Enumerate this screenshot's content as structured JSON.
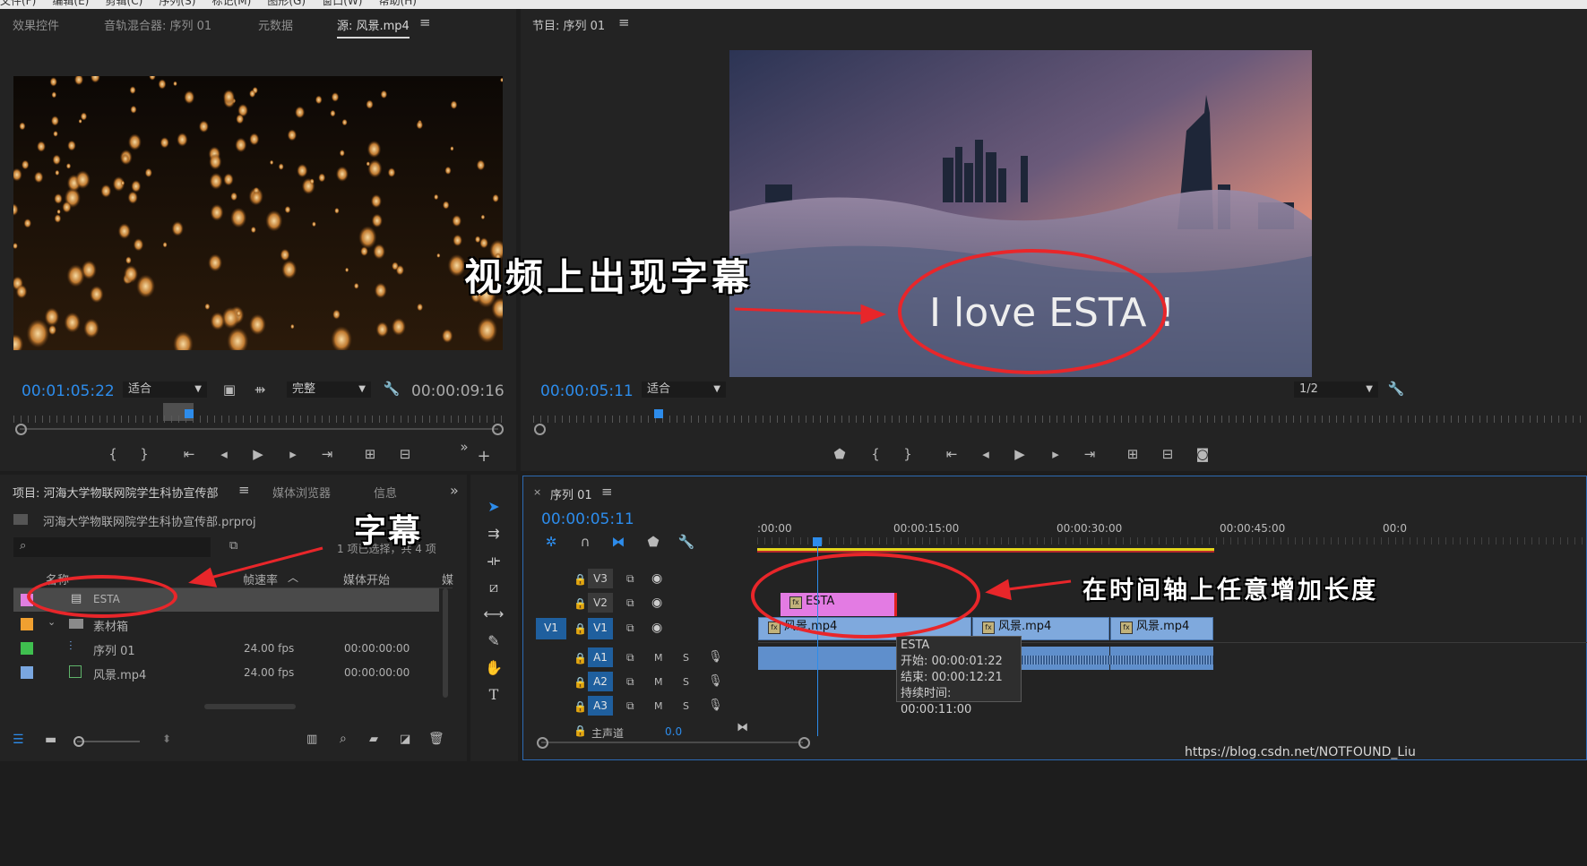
{
  "menubar": [
    "文件(F)",
    "编辑(E)",
    "剪辑(C)",
    "序列(S)",
    "标记(M)",
    "图形(G)",
    "窗口(W)",
    "帮助(H)"
  ],
  "source_panel": {
    "tabs": [
      "效果控件",
      "音轨混合器: 序列 01",
      "元数据",
      "源: 风景.mp4"
    ],
    "timecode_in": "00:01:05:22",
    "fit": "适合",
    "quality": "完整",
    "timecode_out": "00:00:09:16"
  },
  "program_panel": {
    "tab": "节目: 序列 01",
    "timecode": "00:00:05:11",
    "fit": "适合",
    "resolution": "1/2",
    "overlay_title": "I love ESTA !"
  },
  "project_panel": {
    "tabs": [
      "项目: 河海大学物联网院学生科协宣传部",
      "媒体浏览器",
      "信息"
    ],
    "filename": "河海大学物联网院学生科协宣传部.prproj",
    "selection_info": "1 项已选择，共 4 项",
    "columns": [
      "名称",
      "帧速率",
      "媒体开始",
      "媒"
    ],
    "items": [
      {
        "name": "ESTA",
        "fps": "",
        "start": "",
        "color": "#e07fe0",
        "icon": "title-icon"
      },
      {
        "name": "素材箱",
        "fps": "",
        "start": "",
        "color": "#f0a030",
        "icon": "folder-icon"
      },
      {
        "name": "序列 01",
        "fps": "24.00 fps",
        "start": "00:00:00:00",
        "color": "#3fbf4f",
        "icon": "sequence-icon"
      },
      {
        "name": "风景.mp4",
        "fps": "24.00 fps",
        "start": "00:00:00:00",
        "color": "#7aa7e0",
        "icon": "clip-icon"
      }
    ]
  },
  "timeline": {
    "tab": "序列 01",
    "timecode": "00:00:05:11",
    "ruler": [
      ":00:00",
      "00:00:15:00",
      "00:00:30:00",
      "00:00:45:00",
      "00:0"
    ],
    "video_tracks": [
      "V3",
      "V2",
      "V1"
    ],
    "audio_tracks": [
      "A1",
      "A2",
      "A3"
    ],
    "master": "主声道",
    "master_value": "0.0",
    "source_patch": "V1",
    "clips": {
      "title": "ESTA",
      "v1a": "风景.mp4",
      "v1b": "风景.mp4",
      "v1c": "风景.mp4"
    },
    "tooltip": {
      "name": "ESTA",
      "start": "开始: 00:00:01:22",
      "end": "结束: 00:00:12:21",
      "duration": "持续时间: 00:00:11:00"
    }
  },
  "annotations": {
    "video_caption": "视频上出现字幕",
    "subtitle": "字幕",
    "timeline_note": "在时间轴上任意增加长度"
  },
  "watermark": "https://blog.csdn.net/NOTFOUND_Liu",
  "colors": {
    "accent": "#2d8ceb",
    "annotation": "#e8262a",
    "title_clip": "#e07fe0",
    "video_clip": "#7aa7e0"
  }
}
